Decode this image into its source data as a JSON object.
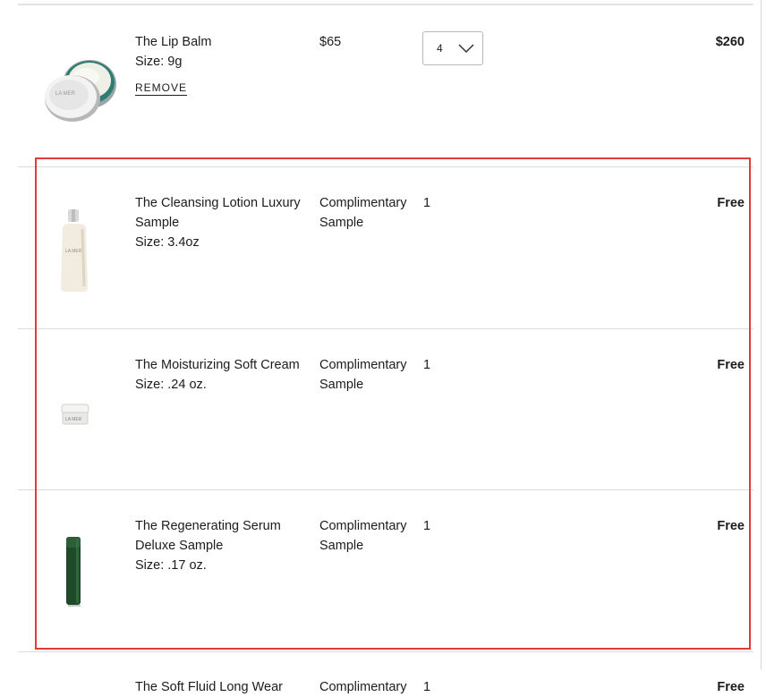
{
  "cart": {
    "items": [
      {
        "name_lines": [
          "The Lip Balm"
        ],
        "size": "Size: 9g",
        "unit_price": "$65",
        "quantity": "4",
        "total": "$260",
        "remove_label": "REMOVE",
        "image_icon": "lip-balm-jar-icon"
      },
      {
        "name_lines": [
          "The Cleansing Lotion Luxury",
          "Sample"
        ],
        "size": "Size: 3.4oz",
        "unit_price_lines": [
          "Complimentary",
          "Sample"
        ],
        "quantity": "1",
        "total": "Free",
        "image_icon": "lotion-bottle-icon"
      },
      {
        "name_lines": [
          "The Moisturizing Soft Cream"
        ],
        "size": "Size: .24 oz.",
        "unit_price_lines": [
          "Complimentary",
          "Sample"
        ],
        "quantity": "1",
        "total": "Free",
        "image_icon": "cream-jar-icon"
      },
      {
        "name_lines": [
          "The Regenerating Serum",
          "Deluxe Sample"
        ],
        "size": "Size: .17 oz.",
        "unit_price_lines": [
          "Complimentary",
          "Sample"
        ],
        "quantity": "1",
        "total": "Free",
        "image_icon": "serum-bottle-icon"
      },
      {
        "name_lines": [
          "The Soft Fluid Long Wear"
        ],
        "unit_price_lines": [
          "Complimentary"
        ],
        "quantity": "1",
        "total": "Free"
      }
    ]
  },
  "colors": {
    "highlight": "#e03c3c",
    "divider": "#dcdcdc",
    "text": "#1c1c1c"
  }
}
